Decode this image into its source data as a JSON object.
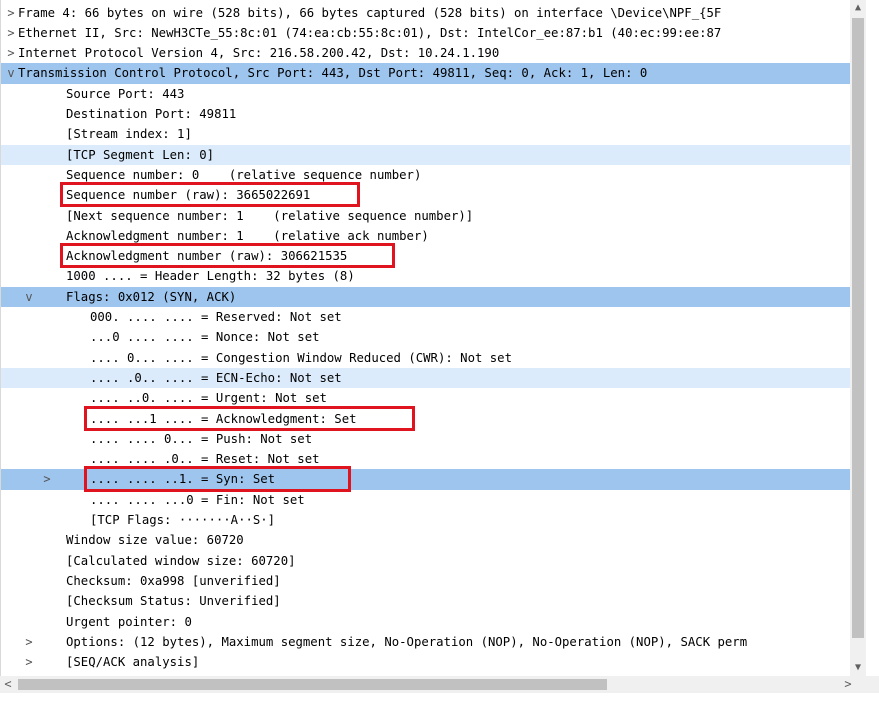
{
  "rows": [
    {
      "indent": 0,
      "toggle": ">",
      "text": "Frame 4: 66 bytes on wire (528 bits), 66 bytes captured (528 bits) on interface \\Device\\NPF_{5F",
      "style": ""
    },
    {
      "indent": 0,
      "toggle": ">",
      "text": "Ethernet II, Src: NewH3CTe_55:8c:01 (74:ea:cb:55:8c:01), Dst: IntelCor_ee:87:b1 (40:ec:99:ee:87",
      "style": ""
    },
    {
      "indent": 0,
      "toggle": ">",
      "text": "Internet Protocol Version 4, Src: 216.58.200.42, Dst: 10.24.1.190",
      "style": ""
    },
    {
      "indent": 0,
      "toggle": "v",
      "text": "Transmission Control Protocol, Src Port: 443, Dst Port: 49811, Seq: 0, Ack: 1, Len: 0",
      "style": "sel-dark"
    },
    {
      "indent": 1,
      "toggle": "",
      "text": "Source Port: 443",
      "style": ""
    },
    {
      "indent": 1,
      "toggle": "",
      "text": "Destination Port: 49811",
      "style": ""
    },
    {
      "indent": 1,
      "toggle": "",
      "text": "[Stream index: 1]",
      "style": ""
    },
    {
      "indent": 1,
      "toggle": "",
      "text": "[TCP Segment Len: 0]",
      "style": "sel-light"
    },
    {
      "indent": 1,
      "toggle": "",
      "text": "Sequence number: 0    (relative sequence number)",
      "style": ""
    },
    {
      "indent": 1,
      "toggle": "",
      "text": "Sequence number (raw): 3665022691",
      "style": ""
    },
    {
      "indent": 1,
      "toggle": "",
      "text": "[Next sequence number: 1    (relative sequence number)]",
      "style": ""
    },
    {
      "indent": 1,
      "toggle": "",
      "text": "Acknowledgment number: 1    (relative ack number)",
      "style": ""
    },
    {
      "indent": 1,
      "toggle": "",
      "text": "Acknowledgment number (raw): 306621535",
      "style": ""
    },
    {
      "indent": 1,
      "toggle": "",
      "text": "1000 .... = Header Length: 32 bytes (8)",
      "style": ""
    },
    {
      "indent": 1,
      "toggle": "v",
      "text": "Flags: 0x012 (SYN, ACK)",
      "style": "sel-dark"
    },
    {
      "indent": 2,
      "toggle": "",
      "text": "000. .... .... = Reserved: Not set",
      "style": ""
    },
    {
      "indent": 2,
      "toggle": "",
      "text": "...0 .... .... = Nonce: Not set",
      "style": ""
    },
    {
      "indent": 2,
      "toggle": "",
      "text": ".... 0... .... = Congestion Window Reduced (CWR): Not set",
      "style": ""
    },
    {
      "indent": 2,
      "toggle": "",
      "text": ".... .0.. .... = ECN-Echo: Not set",
      "style": "sel-light"
    },
    {
      "indent": 2,
      "toggle": "",
      "text": ".... ..0. .... = Urgent: Not set",
      "style": ""
    },
    {
      "indent": 2,
      "toggle": "",
      "text": ".... ...1 .... = Acknowledgment: Set",
      "style": ""
    },
    {
      "indent": 2,
      "toggle": "",
      "text": ".... .... 0... = Push: Not set",
      "style": ""
    },
    {
      "indent": 2,
      "toggle": "",
      "text": ".... .... .0.. = Reset: Not set",
      "style": ""
    },
    {
      "indent": 2,
      "toggle": ">",
      "text": ".... .... ..1. = Syn: Set",
      "style": "sel-dark"
    },
    {
      "indent": 2,
      "toggle": "",
      "text": ".... .... ...0 = Fin: Not set",
      "style": ""
    },
    {
      "indent": 2,
      "toggle": "",
      "text": "[TCP Flags: ·······A··S·]",
      "style": ""
    },
    {
      "indent": 1,
      "toggle": "",
      "text": "Window size value: 60720",
      "style": ""
    },
    {
      "indent": 1,
      "toggle": "",
      "text": "[Calculated window size: 60720]",
      "style": ""
    },
    {
      "indent": 1,
      "toggle": "",
      "text": "Checksum: 0xa998 [unverified]",
      "style": ""
    },
    {
      "indent": 1,
      "toggle": "",
      "text": "[Checksum Status: Unverified]",
      "style": ""
    },
    {
      "indent": 1,
      "toggle": "",
      "text": "Urgent pointer: 0",
      "style": ""
    },
    {
      "indent": 1,
      "toggle": ">",
      "text": "Options: (12 bytes), Maximum segment size, No-Operation (NOP), No-Operation (NOP), SACK perm",
      "style": ""
    },
    {
      "indent": 1,
      "toggle": ">",
      "text": "[SEQ/ACK analysis]",
      "style": ""
    }
  ],
  "highlighted_rows": [
    9,
    12,
    20,
    23
  ],
  "scrollbar": {
    "up_icon": "▲",
    "down_icon": "▼",
    "left_icon": "<",
    "right_icon": ">"
  },
  "colors": {
    "selection_dark": "#9ec5ee",
    "selection_light": "#dcebfb",
    "highlight_box": "#e0141e"
  }
}
